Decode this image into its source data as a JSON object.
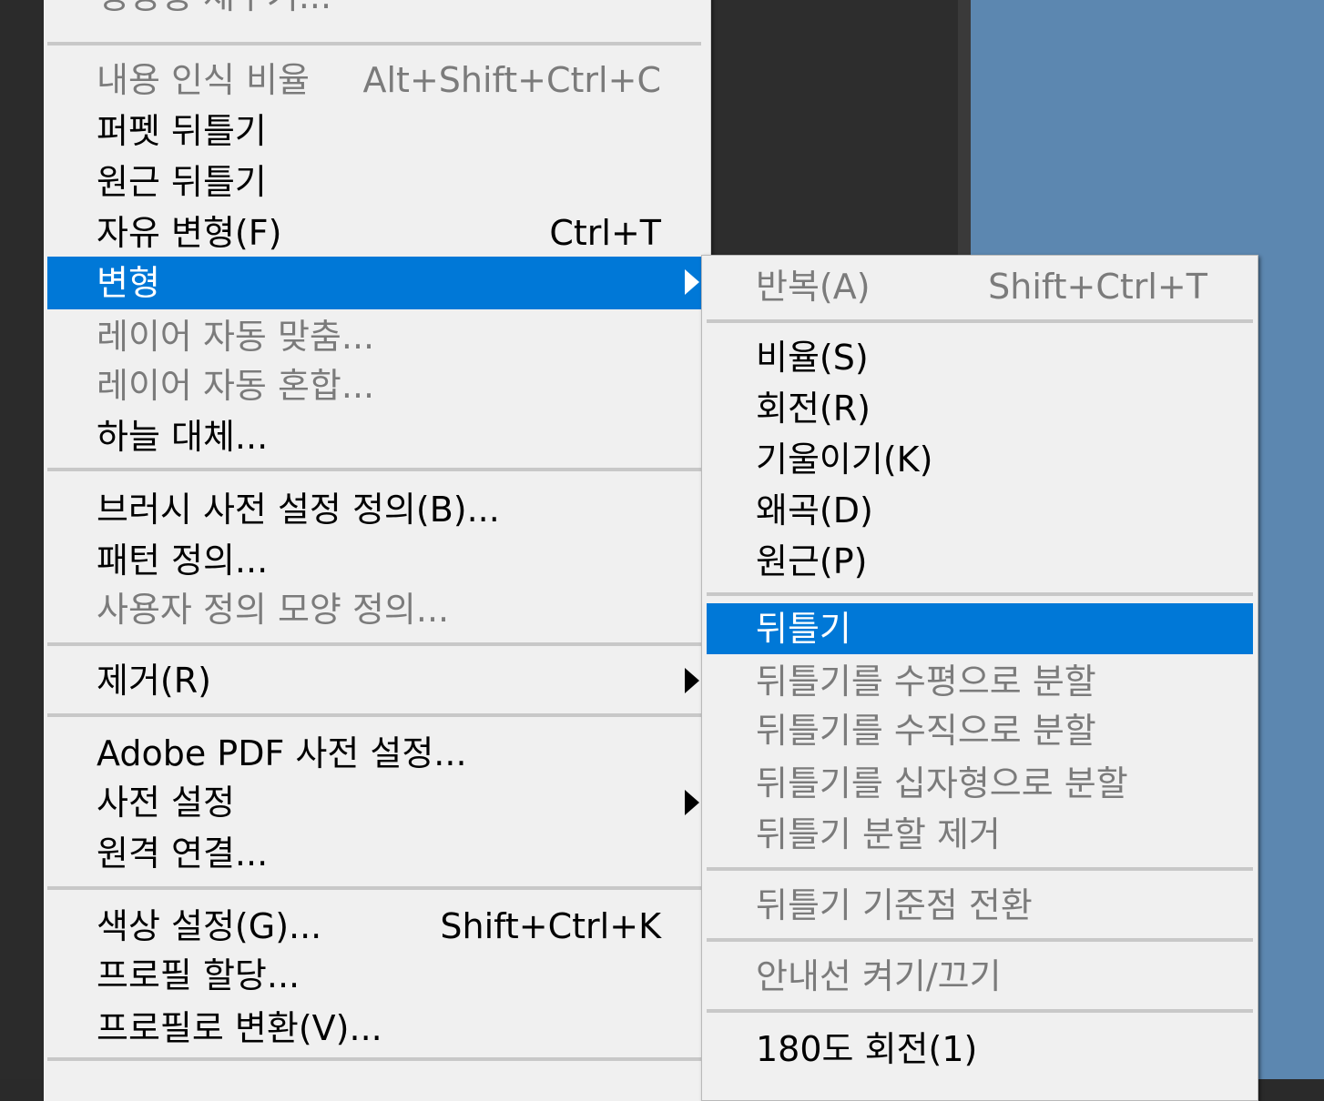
{
  "main_menu": {
    "top_partial": "생성형 채우기...",
    "content_aware_scale": {
      "label": "내용 인식 비율",
      "shortcut": "Alt+Shift+Ctrl+C"
    },
    "puppet_warp": {
      "label": "퍼펫 뒤틀기"
    },
    "perspective_warp": {
      "label": "원근 뒤틀기"
    },
    "free_transform": {
      "label": "자유 변형(F)",
      "shortcut": "Ctrl+T"
    },
    "transform": {
      "label": "변형"
    },
    "auto_align_layers": {
      "label": "레이어 자동 맞춤..."
    },
    "auto_blend_layers": {
      "label": "레이어 자동 혼합..."
    },
    "sky_replacement": {
      "label": "하늘 대체..."
    },
    "define_brush_preset": {
      "label": "브러시 사전 설정 정의(B)..."
    },
    "define_pattern": {
      "label": "패턴 정의..."
    },
    "define_custom_shape": {
      "label": "사용자 정의 모양 정의..."
    },
    "purge": {
      "label": "제거(R)"
    },
    "adobe_pdf_presets": {
      "label": "Adobe PDF 사전 설정..."
    },
    "presets": {
      "label": "사전 설정"
    },
    "remote_connections": {
      "label": "원격 연결..."
    },
    "color_settings": {
      "label": "색상 설정(G)...",
      "shortcut": "Shift+Ctrl+K"
    },
    "assign_profile": {
      "label": "프로필 할당..."
    },
    "convert_to_profile": {
      "label": "프로필로 변환(V)..."
    }
  },
  "transform_submenu": {
    "again": {
      "label": "반복(A)",
      "shortcut": "Shift+Ctrl+T"
    },
    "scale": {
      "label": "비율(S)"
    },
    "rotate": {
      "label": "회전(R)"
    },
    "skew": {
      "label": "기울이기(K)"
    },
    "distort": {
      "label": "왜곡(D)"
    },
    "perspective": {
      "label": "원근(P)"
    },
    "warp": {
      "label": "뒤틀기"
    },
    "split_warp_horizontal": {
      "label": "뒤틀기를 수평으로 분할"
    },
    "split_warp_vertical": {
      "label": "뒤틀기를 수직으로 분할"
    },
    "split_warp_crosswise": {
      "label": "뒤틀기를 십자형으로 분할"
    },
    "remove_warp_split": {
      "label": "뒤틀기 분할 제거"
    },
    "toggle_reference_point": {
      "label": "뒤틀기 기준점 전환"
    },
    "toggle_guides": {
      "label": "안내선 켜기/끄기"
    },
    "rotate_180": {
      "label": "180도 회전(1)"
    }
  },
  "colors": {
    "highlight": "#0078d7",
    "menu_bg": "#f0f0f0",
    "disabled_text": "#7b7b7b",
    "canvas": "#5c87b0"
  }
}
